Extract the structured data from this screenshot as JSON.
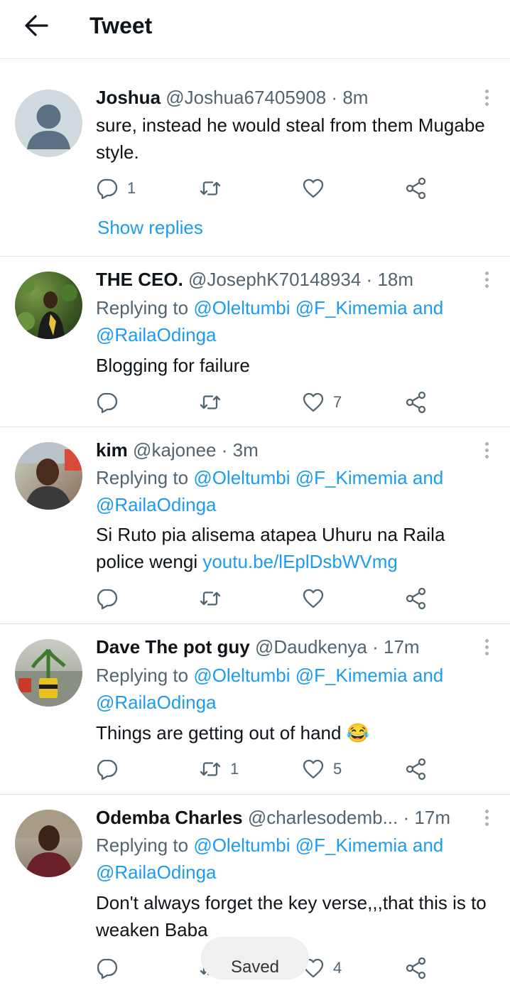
{
  "header": {
    "title": "Tweet"
  },
  "tweets": [
    {
      "name": "Joshua",
      "handle": "@Joshua67405908",
      "time": "8m",
      "body": "sure, instead he would steal from them Mugabe style.",
      "replies": "1",
      "retweets": "",
      "likes": "",
      "show_replies": "Show replies"
    },
    {
      "name": "THE CEO.",
      "handle": "@JosephK70148934",
      "time": "18m",
      "replying_prefix": "Replying to",
      "mention1": "@Oleltumbi",
      "mention2": "@F_Kimemia",
      "and": "and",
      "mention3": "@RailaOdinga",
      "body": "Blogging for failure",
      "replies": "",
      "retweets": "",
      "likes": "7"
    },
    {
      "name": "kim",
      "handle": "@kajonee",
      "time": "3m",
      "replying_prefix": "Replying to",
      "mention1": "@Oleltumbi",
      "mention2": "@F_Kimemia",
      "and": "and",
      "mention3": "@RailaOdinga",
      "body": "Si Ruto pia alisema atapea Uhuru na Raila police wengi",
      "link": "youtu.be/lEplDsbWVmg",
      "replies": "",
      "retweets": "",
      "likes": ""
    },
    {
      "name": "Dave The pot guy",
      "handle": "@Daudkenya",
      "time": "17m",
      "replying_prefix": "Replying to",
      "mention1": "@Oleltumbi",
      "mention2": "@F_Kimemia",
      "and": "and",
      "mention3": "@RailaOdinga",
      "body": "Things are getting out of hand",
      "emoji": "😂",
      "replies": "",
      "retweets": "1",
      "likes": "5"
    },
    {
      "name": "Odemba Charles",
      "handle": "@charlesodemb...",
      "time": "17m",
      "replying_prefix": "Replying to",
      "mention1": "@Oleltumbi",
      "mention2": "@F_Kimemia",
      "and": "and",
      "mention3": "@RailaOdinga",
      "body": "Don't always forget the key verse,,,that this is to weaken Baba",
      "replies": "",
      "retweets": "",
      "likes": "4"
    }
  ],
  "toast": {
    "text": "Saved"
  },
  "colors": {
    "accent": "#1d9bf0",
    "muted": "#536471",
    "text": "#0f1419"
  }
}
